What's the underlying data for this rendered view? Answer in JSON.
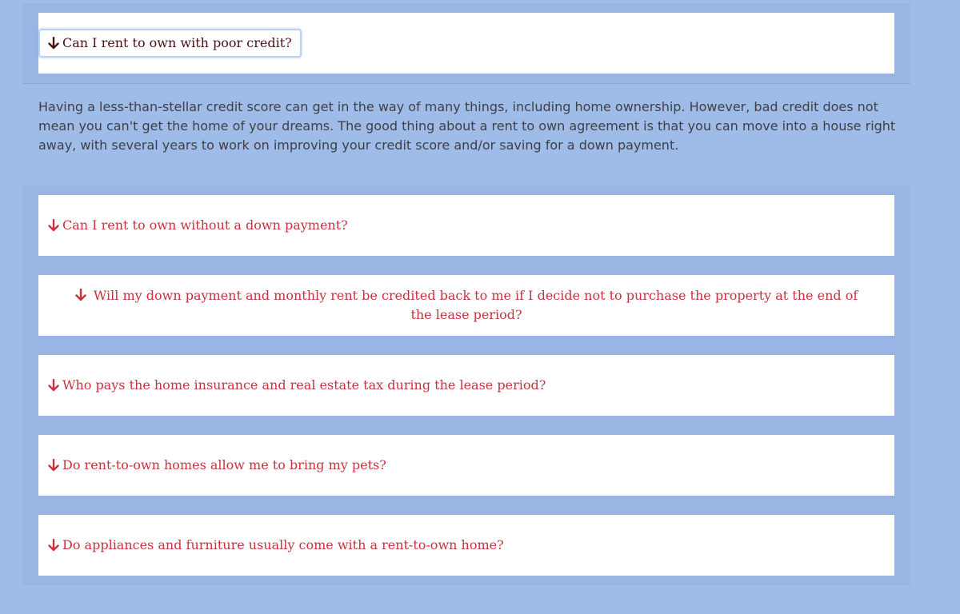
{
  "faq": {
    "open_item": {
      "question": "Can I rent to own with poor credit?",
      "answer": "Having a less-than-stellar credit score can get in the way of many things, including home ownership. However, bad credit does not mean you can't get the home of your dreams. The good thing about a rent to own agreement is that you can move into a house right away, with several years to work on improving your credit score and/or saving for a down payment."
    },
    "items": [
      {
        "question": "Can I rent to own without a down payment?"
      },
      {
        "question": "Will my down payment and monthly rent be credited back to me if I decide not to purchase the property at the end of the lease period?"
      },
      {
        "question": "Who pays the home insurance and real estate tax during the lease period?"
      },
      {
        "question": "Do rent-to-own homes allow me to bring my pets?"
      },
      {
        "question": "Do appliances and furniture usually come with a rent-to-own home?"
      }
    ]
  },
  "colors": {
    "background": "#9fbbe8",
    "group_background": "#98b5e3",
    "card_background": "#ffffff",
    "question_link": "#c8323c",
    "active_question": "#4a1014",
    "answer_text": "#3f3f46"
  },
  "icons": {
    "toggle": "arrow-down-icon"
  }
}
